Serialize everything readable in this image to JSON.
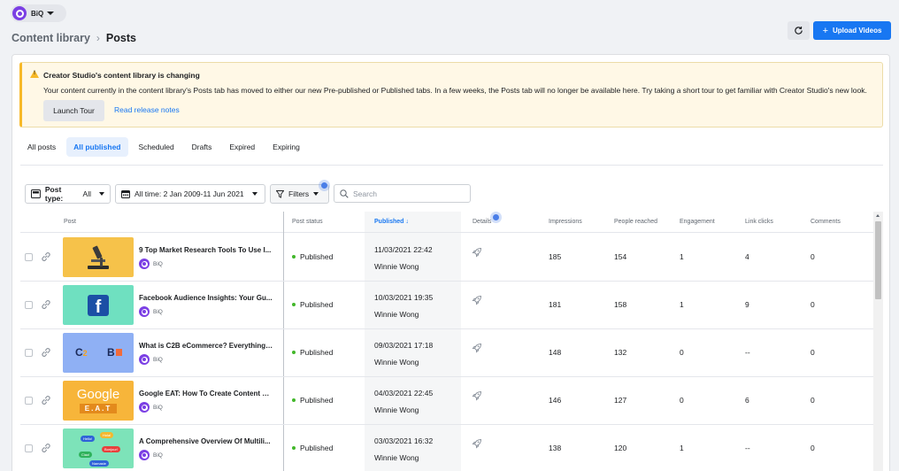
{
  "account": {
    "name": "BiQ"
  },
  "breadcrumb": {
    "parent": "Content library",
    "current": "Posts"
  },
  "actions": {
    "upload_label": "Upload Videos"
  },
  "banner": {
    "title": "Creator Studio's content library is changing",
    "text": "Your content currently in the content library's Posts tab has moved to either our new Pre-published or Published tabs. In a few weeks, the Posts tab will no longer be available here. Try taking a short tour to get familiar with Creator Studio's new look.",
    "tour_label": "Launch Tour",
    "notes_label": "Read release notes"
  },
  "tabs": [
    "All posts",
    "All published",
    "Scheduled",
    "Drafts",
    "Expired",
    "Expiring"
  ],
  "active_tab": "All published",
  "filters": {
    "post_type_label": "Post type:",
    "post_type_value": "All",
    "date_range": "All time: 2 Jan 2009-11 Jun 2021",
    "filters_label": "Filters",
    "search_placeholder": "Search"
  },
  "columns": {
    "post": "Post",
    "status": "Post status",
    "published": "Published ↓",
    "details": "Details",
    "impressions": "Impressions",
    "reached": "People reached",
    "engagement": "Engagement",
    "clicks": "Link clicks",
    "comments": "Comments"
  },
  "rows": [
    {
      "title": "9 Top Market Research Tools To Use I...",
      "account": "BiQ",
      "status": "Published",
      "date": "11/03/2021 22:42",
      "author": "Winnie Wong",
      "impressions": "185",
      "reached": "154",
      "engagement": "1",
      "clicks": "4",
      "comments": "0",
      "thumb": "microscope"
    },
    {
      "title": "Facebook Audience Insights: Your Gu...",
      "account": "BiQ",
      "status": "Published",
      "date": "10/03/2021 19:35",
      "author": "Winnie Wong",
      "impressions": "181",
      "reached": "158",
      "engagement": "1",
      "clicks": "9",
      "comments": "0",
      "thumb": "facebook"
    },
    {
      "title": "What is C2B eCommerce? Everything ...",
      "account": "BiQ",
      "status": "Published",
      "date": "09/03/2021 17:18",
      "author": "Winnie Wong",
      "impressions": "148",
      "reached": "132",
      "engagement": "0",
      "clicks": "--",
      "comments": "0",
      "thumb": "c2b"
    },
    {
      "title": "Google EAT: How To Create Content G...",
      "account": "BiQ",
      "status": "Published",
      "date": "04/03/2021 22:45",
      "author": "Winnie Wong",
      "impressions": "146",
      "reached": "127",
      "engagement": "0",
      "clicks": "6",
      "comments": "0",
      "thumb": "google"
    },
    {
      "title": "A Comprehensive Overview Of Multili...",
      "account": "BiQ",
      "status": "Published",
      "date": "03/03/2021 16:32",
      "author": "Winnie Wong",
      "impressions": "138",
      "reached": "120",
      "engagement": "1",
      "clicks": "--",
      "comments": "0",
      "thumb": "bubbles"
    }
  ],
  "thumb_text": {
    "google_word": "Google",
    "eat": "E.A.T",
    "c2b_left": "C",
    "c2b_right": "B",
    "b1": "Hello!",
    "b2": "Hola!",
    "b3": "Bonjour!",
    "b4": "Ciao!",
    "b5": "Namaste"
  },
  "colors": {
    "accent": "#1877f2",
    "brand": "#7b3fe4",
    "published": "#42b72a",
    "warning": "#f7b928"
  }
}
